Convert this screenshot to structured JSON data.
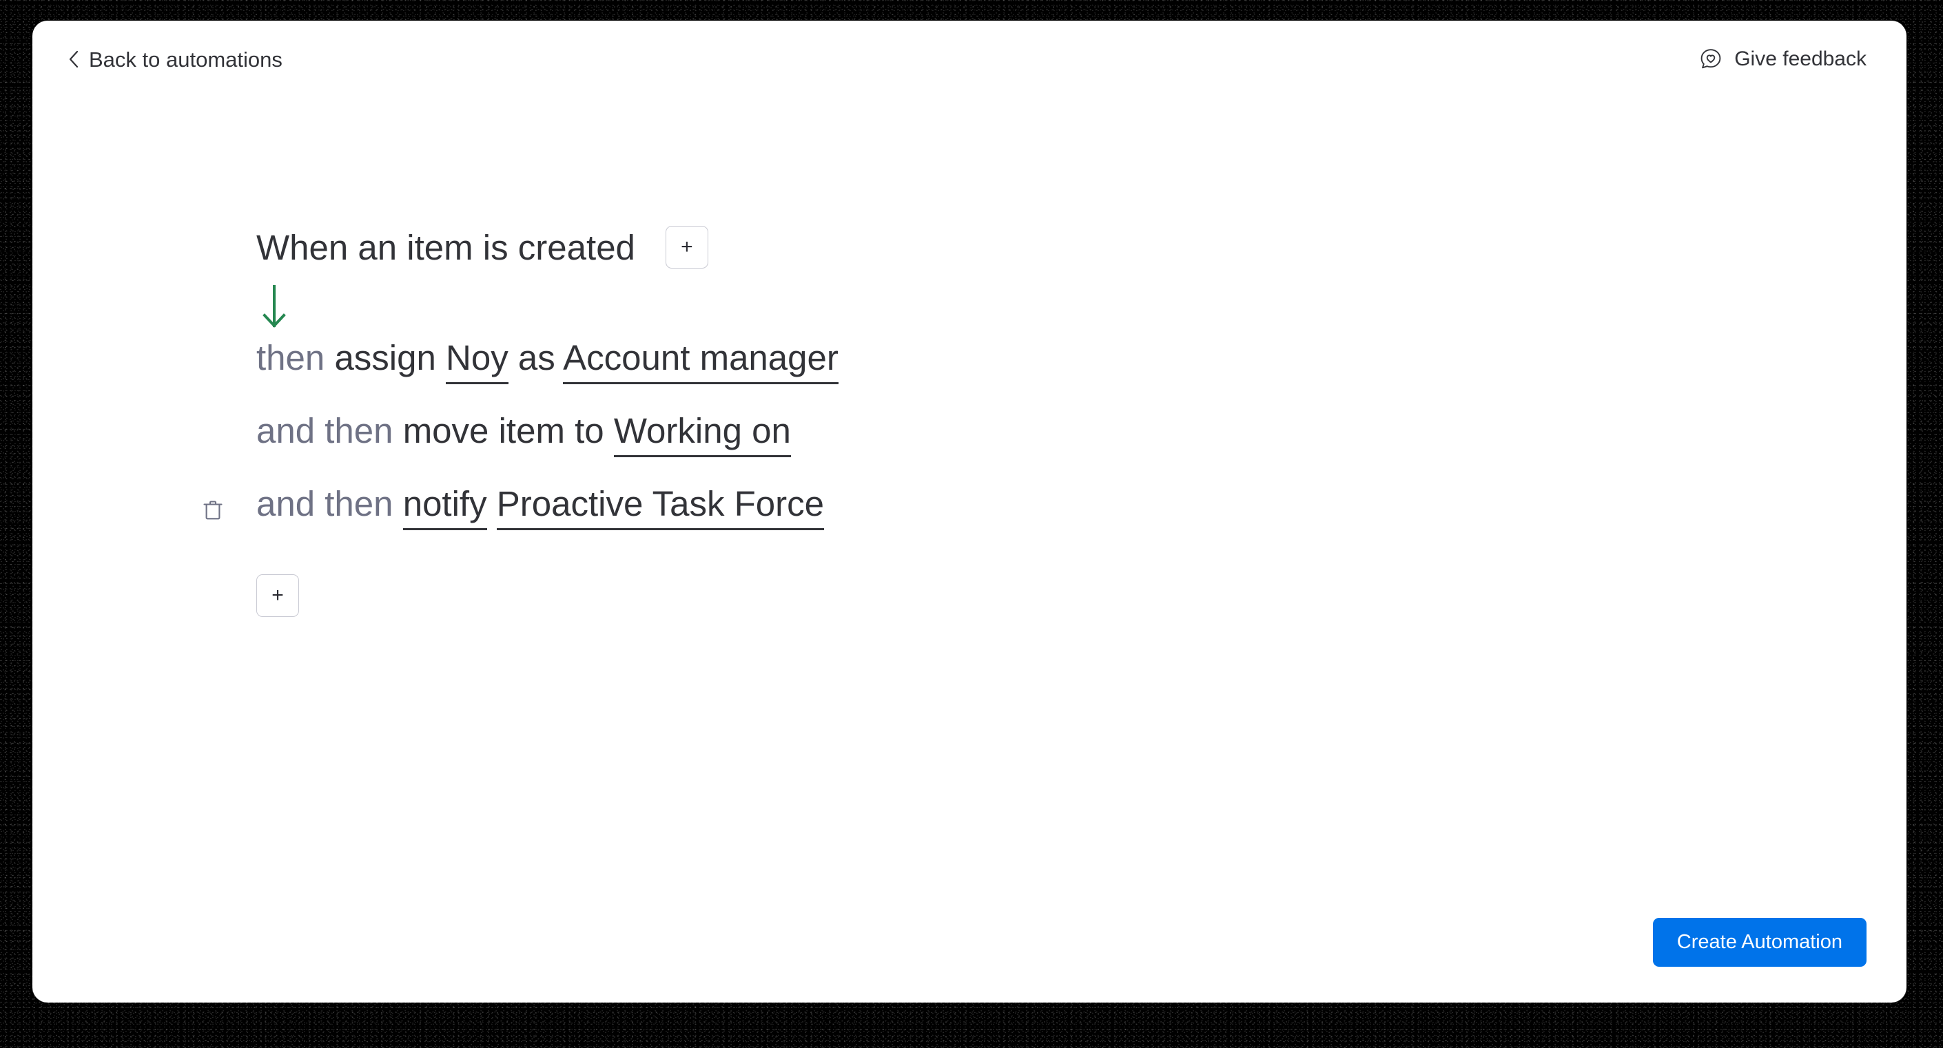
{
  "topbar": {
    "back_label": "Back to automations",
    "back_icon": "chevron-left-icon",
    "feedback_label": "Give feedback",
    "feedback_icon": "speech-bubble-heart-icon"
  },
  "recipe": {
    "trigger": {
      "text": "When an item is created",
      "add_condition_label": "+"
    },
    "connector_icon": "arrow-down-icon",
    "connector_color": "#258750",
    "actions": [
      {
        "tokens": [
          {
            "type": "keyword",
            "text": "then"
          },
          {
            "type": "plain",
            "text": "assign"
          },
          {
            "type": "field",
            "text": "Noy"
          },
          {
            "type": "plain",
            "text": "as"
          },
          {
            "type": "field",
            "text": "Account manager"
          }
        ],
        "has_delete": false,
        "delete_icon": "trash-icon"
      },
      {
        "tokens": [
          {
            "type": "keyword",
            "text": "and then"
          },
          {
            "type": "plain",
            "text": "move item to"
          },
          {
            "type": "field",
            "text": "Working on"
          }
        ],
        "has_delete": false,
        "delete_icon": "trash-icon"
      },
      {
        "tokens": [
          {
            "type": "keyword",
            "text": "and then"
          },
          {
            "type": "field",
            "text": "notify"
          },
          {
            "type": "field",
            "text": "Proactive Task Force"
          }
        ],
        "has_delete": true,
        "delete_icon": "trash-icon"
      }
    ],
    "add_action_label": "+"
  },
  "footer": {
    "primary_label": "Create Automation",
    "primary_color": "#0073ea"
  },
  "colors": {
    "text_dark": "#323338",
    "text_muted": "#6f7285",
    "accent_blue": "#0073ea",
    "accent_green": "#258750",
    "border": "#c9cad3",
    "surface": "#ffffff",
    "backdrop": "#000000"
  }
}
